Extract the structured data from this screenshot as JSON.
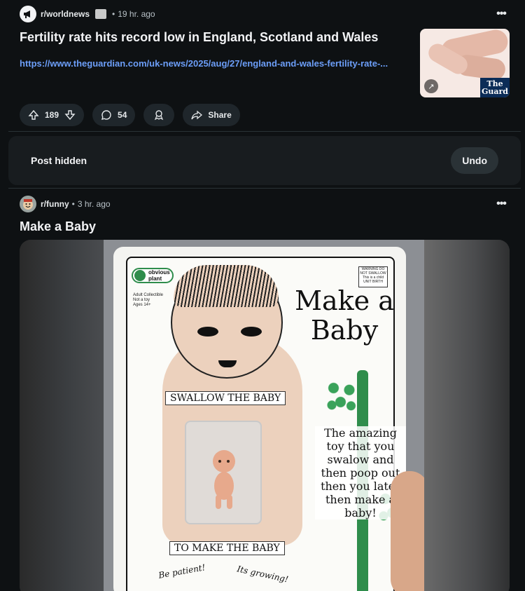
{
  "post1": {
    "subreddit": "r/worldnews",
    "age": "19 hr. ago",
    "title": "Fertility rate hits record low in England, Scotland and Wales",
    "link": "https://www.theguardian.com/uk-news/2025/aug/27/england-and-wales-fertility-rate-...",
    "thumbnail_logo": "The Guard",
    "upvotes": "189",
    "comments": "54",
    "share_label": "Share",
    "more": "•••"
  },
  "hidden": {
    "label": "Post hidden",
    "undo_label": "Undo"
  },
  "post2": {
    "subreddit": "r/funny",
    "age": "3 hr. ago",
    "title": "Make a Baby",
    "more": "•••",
    "image_text": {
      "brand": "obvious plant",
      "fine_print": "Adult Collectible\nNot a toy\nAges 14+",
      "warning": "WARNING DO NOT SWALLOW This is a child UNIT BIRTH",
      "title": "Make a Baby",
      "swallow": "SWALLOW THE BABY",
      "blurb": "The amazing toy that you swalow and then poop out then you later then make a baby!",
      "to_make": "TO MAKE THE BABY",
      "patient": "Be patient!",
      "growing": "Its growing!"
    }
  },
  "colors": {
    "background": "#0e1113",
    "card": "#181c1f",
    "pill": "#1f262b",
    "link": "#6c9ef8",
    "vine_green": "#2f8d4c"
  }
}
